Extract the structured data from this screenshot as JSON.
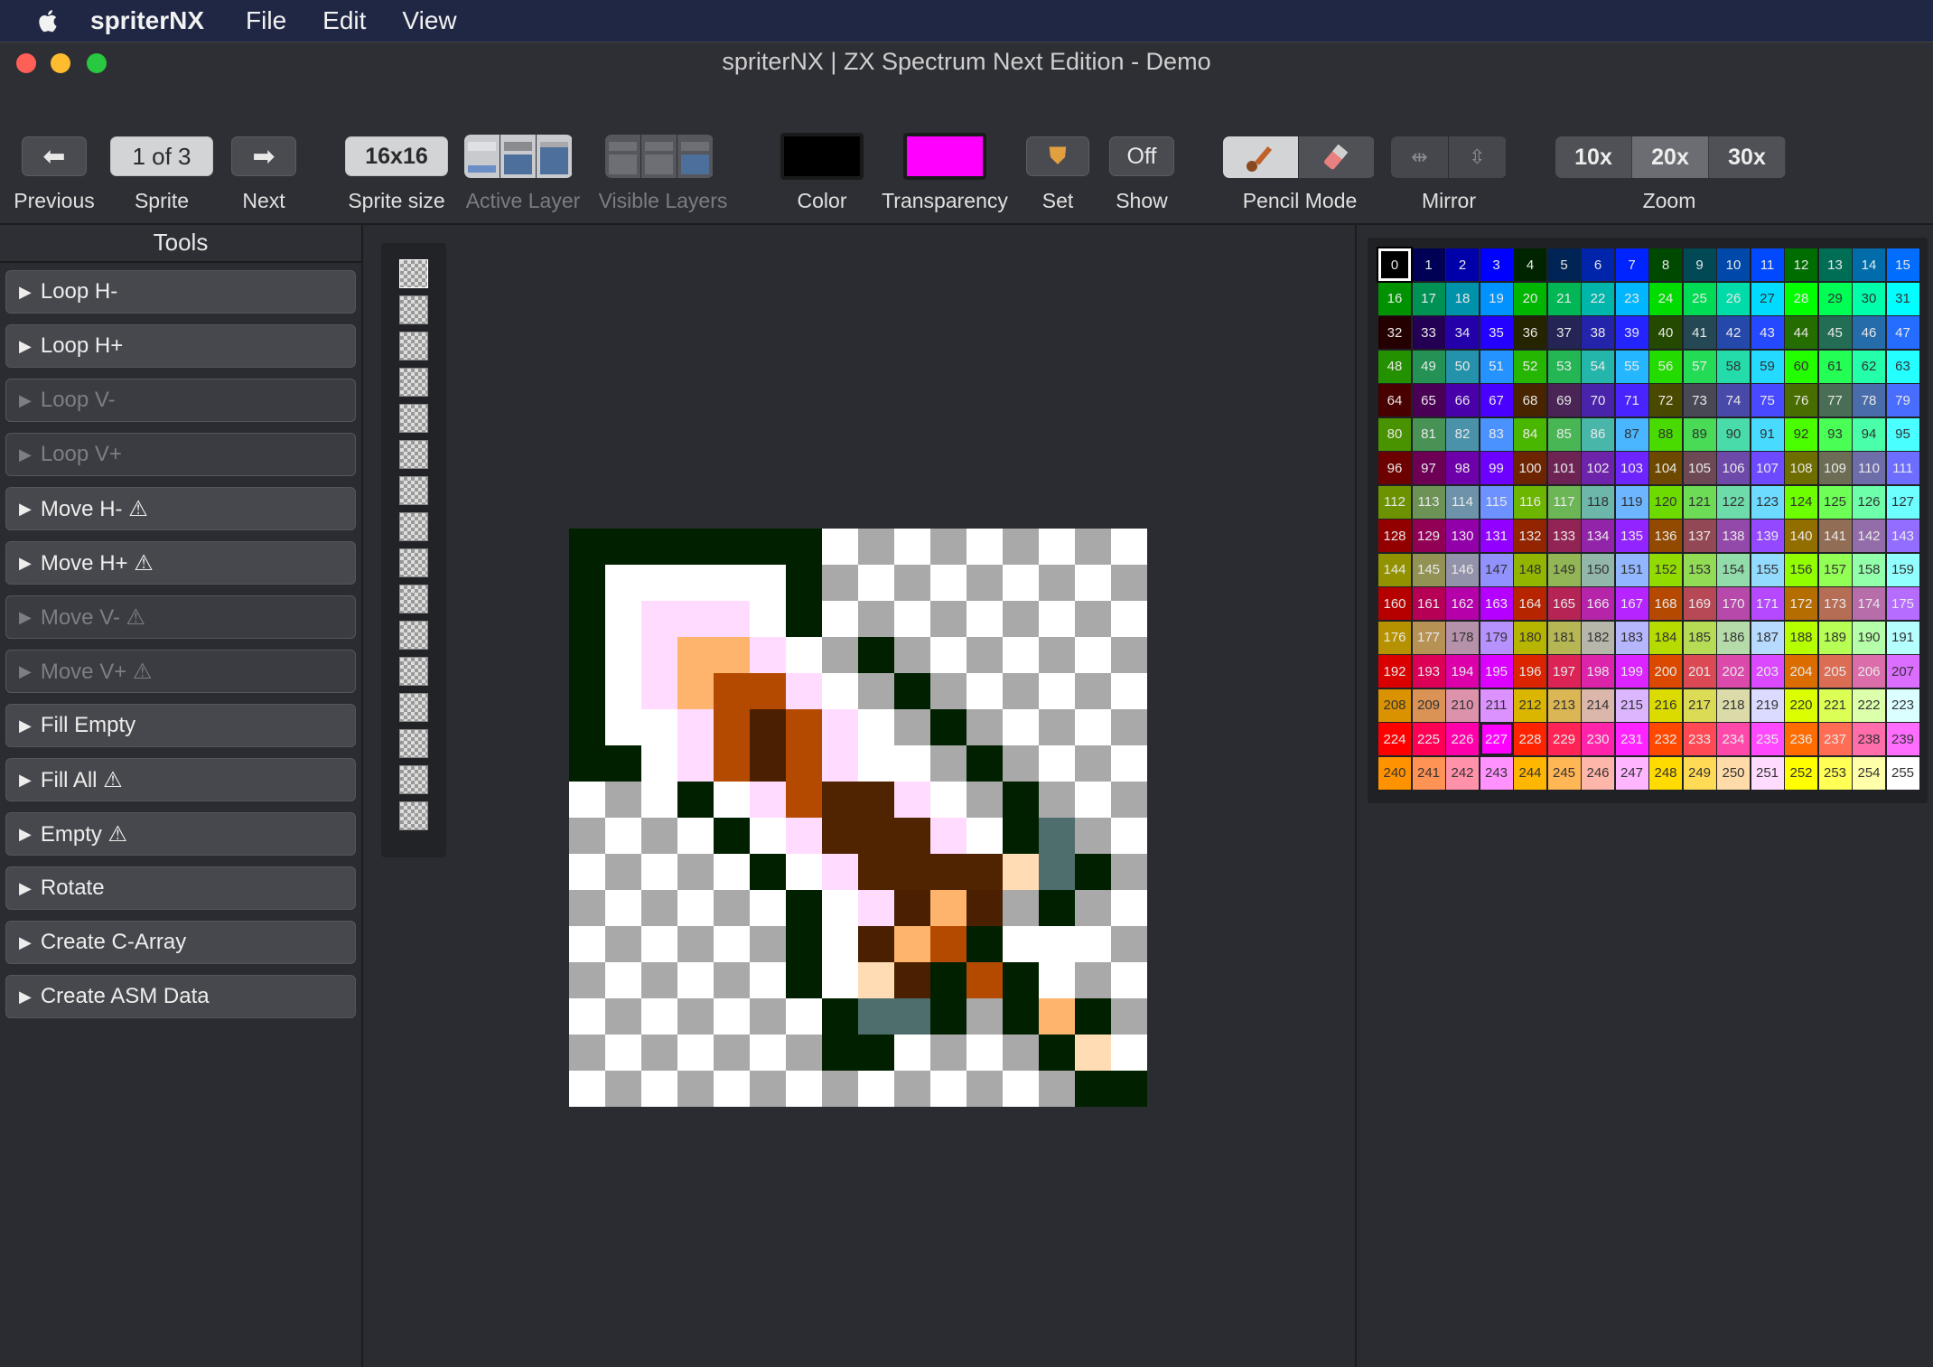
{
  "menubar": {
    "app": "spriterNX",
    "items": [
      "File",
      "Edit",
      "View"
    ]
  },
  "window": {
    "title": "spriterNX | ZX Spectrum Next Edition - Demo"
  },
  "toolbar": {
    "previous_label": "Previous",
    "sprite_counter": "1 of 3",
    "sprite_label": "Sprite",
    "next_label": "Next",
    "sprite_size_value": "16x16",
    "sprite_size_label": "Sprite size",
    "active_layer_label": "Active Layer",
    "visible_layers_label": "Visible Layers",
    "color_label": "Color",
    "color_value": "#000000",
    "transparency_label": "Transparency",
    "transparency_value": "#ff00ff",
    "set_label": "Set",
    "show_value": "Off",
    "show_label": "Show",
    "pencil_mode_label": "Pencil Mode",
    "mirror_label": "Mirror",
    "zoom_label": "Zoom",
    "zoom_options": [
      "10x",
      "20x",
      "30x"
    ],
    "zoom_selected": "20x"
  },
  "tools": {
    "header": "Tools",
    "items": [
      {
        "label": "Loop H-",
        "enabled": true
      },
      {
        "label": "Loop H+",
        "enabled": true
      },
      {
        "label": "Loop V-",
        "enabled": false
      },
      {
        "label": "Loop V+",
        "enabled": false
      },
      {
        "label": "Move H- ⚠",
        "enabled": true
      },
      {
        "label": "Move H+ ⚠",
        "enabled": true
      },
      {
        "label": "Move V- ⚠",
        "enabled": false
      },
      {
        "label": "Move V+ ⚠",
        "enabled": false
      },
      {
        "label": "Fill Empty",
        "enabled": true
      },
      {
        "label": "Fill All ⚠",
        "enabled": true
      },
      {
        "label": "Empty ⚠",
        "enabled": true
      },
      {
        "label": "Rotate",
        "enabled": true
      },
      {
        "label": "Create C-Array",
        "enabled": true
      },
      {
        "label": "Create ASM Data",
        "enabled": true
      }
    ]
  },
  "sprite": {
    "size": 16,
    "legend": {
      "G": "#002000",
      "W": "#ffffff",
      "P": "#ffdcff",
      "O": "#ffb46e",
      "R": "#b44a00",
      "D": "#4a2000",
      "B": "#502400",
      "T": "#4e6e6e",
      "S": "#ffdcb4"
    },
    "rows": [
      "GGGGGGG.........",
      "GWWWWWG.........",
      "GWPPPWG.........",
      "GWPOOPW.G.......",
      "GWPORRPW.G......",
      "GWWPRDRPW.G.....",
      "GGWPRDRPWW.G....",
      "...GWPRBBPW.G...",
      "....GWPBBBPWGT..",
      ".....GWPBBBBSTG.",
      "......GWPDOD.G..",
      "......GWDORG.W..",
      "......GWSDGRG...",
      ".......GTTG.GOG.",
      ".......GG....GS.",
      "..............GG"
    ]
  },
  "palette": {
    "selected_index": 0,
    "highlight_index": 227,
    "count": 256
  },
  "thumbnail_count": 16
}
